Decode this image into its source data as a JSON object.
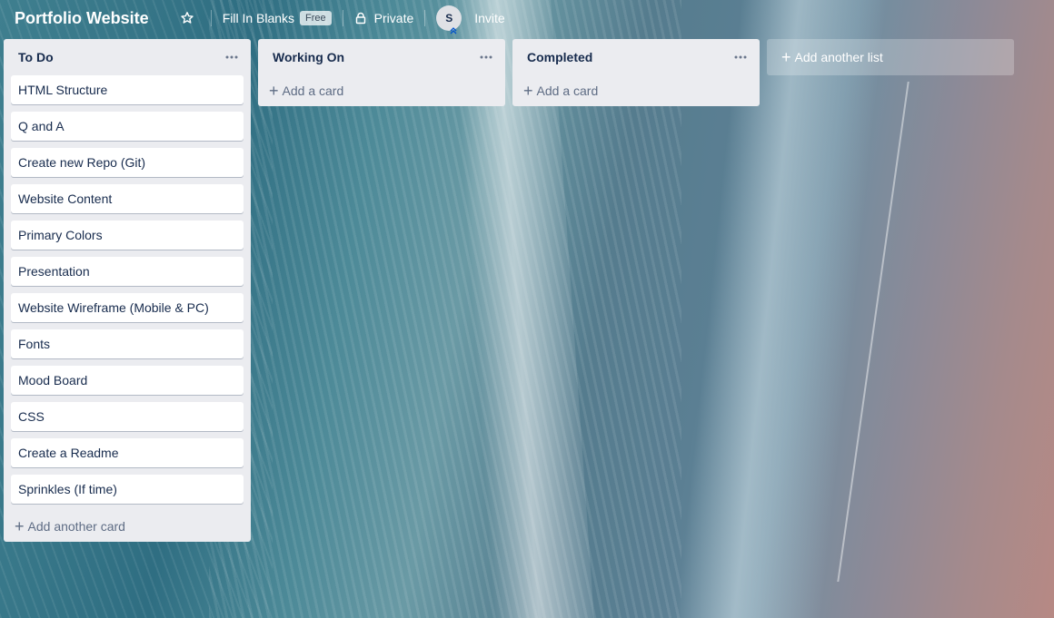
{
  "board": {
    "title": "Portfolio Website",
    "workspace": "Fill In Blanks",
    "workspace_badge": "Free",
    "visibility": "Private",
    "member_initial": "S",
    "invite_label": "Invite"
  },
  "lists": [
    {
      "title": "To Do",
      "cards": [
        "HTML Structure",
        "Q and A",
        "Create new Repo (Git)",
        "Website Content",
        "Primary Colors",
        "Presentation",
        "Website Wireframe (Mobile & PC)",
        "Fonts",
        "Mood Board",
        "CSS",
        "Create a Readme",
        "Sprinkles (If time)"
      ],
      "add_label": "Add another card"
    },
    {
      "title": "Working On",
      "cards": [],
      "add_label": "Add a card"
    },
    {
      "title": "Completed",
      "cards": [],
      "add_label": "Add a card"
    }
  ],
  "add_list_label": "Add another list",
  "icons": {
    "star": "star-icon",
    "lock": "lock-icon",
    "menu": "dots-icon",
    "add": "plus-icon",
    "admin": "chevron-up-icon"
  },
  "colors": {
    "list_bg": "#ebecf0",
    "card_bg": "#ffffff",
    "text": "#172b4d",
    "muted": "#5e6c84"
  }
}
